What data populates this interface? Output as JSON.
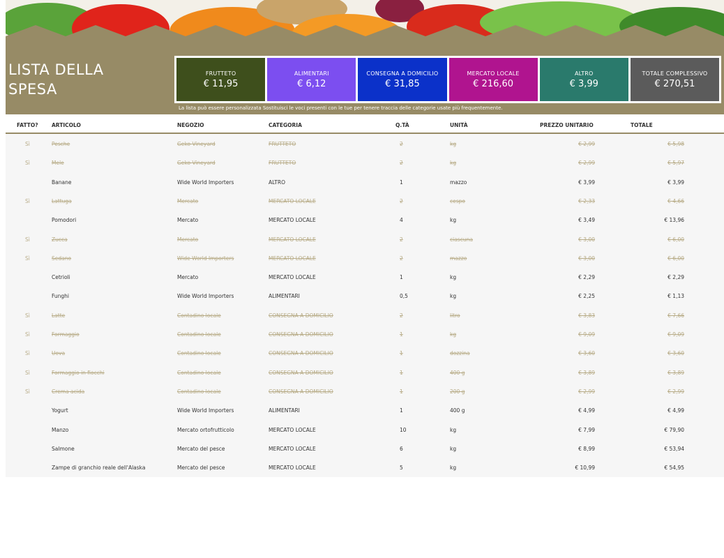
{
  "header": {
    "title_line1": "LISTA DELLA",
    "title_line2": "SPESA",
    "note": "La lista può essere personalizzata Sostituisci le voci presenti con le tue per tenere traccia delle categorie usate più frequentemente."
  },
  "summary": [
    {
      "label": "FRUTTETO",
      "value": "€ 11,95",
      "color": "#3e4f1c"
    },
    {
      "label": "ALIMENTARI",
      "value": "€ 6,12",
      "color": "#7c4ef0"
    },
    {
      "label": "CONSEGNA A DOMICILIO",
      "value": "€ 31,85",
      "color": "#0b31c9"
    },
    {
      "label": "MERCATO LOCALE",
      "value": "€ 216,60",
      "color": "#b0148f"
    },
    {
      "label": "ALTRO",
      "value": "€ 3,99",
      "color": "#2a7a6c"
    },
    {
      "label": "TOTALE COMPLESSIVO",
      "value": "€ 270,51",
      "color": "#5b5b5b"
    }
  ],
  "columns": {
    "fatto": "FATTO?",
    "articolo": "ARTICOLO",
    "negozio": "NEGOZIO",
    "categoria": "CATEGORIA",
    "qta": "Q.TÀ",
    "unita": "UNITÀ",
    "prezzo": "PREZZO UNITARIO",
    "totale": "TOTALE"
  },
  "rows": [
    {
      "done": true,
      "fatto": "Sì",
      "articolo": "Pesche",
      "negozio": "Geko Vineyard",
      "categoria": "FRUTTETO",
      "qta": "2",
      "unita": "kg",
      "prezzo": "€ 2,99",
      "totale": "€ 5,98"
    },
    {
      "done": true,
      "fatto": "Sì",
      "articolo": "Mele",
      "negozio": "Geko Vineyard",
      "categoria": "FRUTTETO",
      "qta": "2",
      "unita": "kg",
      "prezzo": "€ 2,99",
      "totale": "€ 5,97"
    },
    {
      "done": false,
      "fatto": "",
      "articolo": "Banane",
      "negozio": "Wide World Importers",
      "categoria": "ALTRO",
      "qta": "1",
      "unita": "mazzo",
      "prezzo": "€ 3,99",
      "totale": "€ 3,99"
    },
    {
      "done": true,
      "fatto": "Sì",
      "articolo": "Lattuga",
      "negozio": "Mercato",
      "categoria": "MERCATO LOCALE",
      "qta": "2",
      "unita": "cespo",
      "prezzo": "€ 2,33",
      "totale": "€ 4,66"
    },
    {
      "done": false,
      "fatto": "",
      "articolo": "Pomodori",
      "negozio": "Mercato",
      "categoria": "MERCATO LOCALE",
      "qta": "4",
      "unita": "kg",
      "prezzo": "€ 3,49",
      "totale": "€ 13,96"
    },
    {
      "done": true,
      "fatto": "Sì",
      "articolo": "Zucca",
      "negozio": "Mercato",
      "categoria": "MERCATO LOCALE",
      "qta": "2",
      "unita": "ciascuna",
      "prezzo": "€ 3,00",
      "totale": "€ 6,00"
    },
    {
      "done": true,
      "fatto": "Sì",
      "articolo": "Sedano",
      "negozio": "Wide World Importers",
      "categoria": "MERCATO LOCALE",
      "qta": "2",
      "unita": "mazzo",
      "prezzo": "€ 3,00",
      "totale": "€ 6,00"
    },
    {
      "done": false,
      "fatto": "",
      "articolo": "Cetrioli",
      "negozio": "Mercato",
      "categoria": "MERCATO LOCALE",
      "qta": "1",
      "unita": "kg",
      "prezzo": "€ 2,29",
      "totale": "€ 2,29"
    },
    {
      "done": false,
      "fatto": "",
      "articolo": "Funghi",
      "negozio": "Wide World Importers",
      "categoria": "ALIMENTARI",
      "qta": "0,5",
      "unita": "kg",
      "prezzo": "€ 2,25",
      "totale": "€ 1,13"
    },
    {
      "done": true,
      "fatto": "Sì",
      "articolo": "Latte",
      "negozio": "Contadino locale",
      "categoria": "CONSEGNA A DOMICILIO",
      "qta": "2",
      "unita": "litro",
      "prezzo": "€ 3,83",
      "totale": "€ 7,66"
    },
    {
      "done": true,
      "fatto": "Sì",
      "articolo": "Formaggio",
      "negozio": "Contadino locale",
      "categoria": "CONSEGNA A DOMICILIO",
      "qta": "1",
      "unita": "kg",
      "prezzo": "€ 9,09",
      "totale": "€ 9,09"
    },
    {
      "done": true,
      "fatto": "Sì",
      "articolo": "Uova",
      "negozio": "Contadino locale",
      "categoria": "CONSEGNA A DOMICILIO",
      "qta": "1",
      "unita": "dozzina",
      "prezzo": "€ 3,60",
      "totale": "€ 3,60"
    },
    {
      "done": true,
      "fatto": "Sì",
      "articolo": "Formaggio in fiocchi",
      "negozio": "Contadino locale",
      "categoria": "CONSEGNA A DOMICILIO",
      "qta": "1",
      "unita": "400 g",
      "prezzo": "€ 3,89",
      "totale": "€ 3,89"
    },
    {
      "done": true,
      "fatto": "Sì",
      "articolo": "Crema acida",
      "negozio": "Contadino locale",
      "categoria": "CONSEGNA A DOMICILIO",
      "qta": "1",
      "unita": "200 g",
      "prezzo": "€ 2,99",
      "totale": "€ 2,99"
    },
    {
      "done": false,
      "fatto": "",
      "articolo": "Yogurt",
      "negozio": "Wide World Importers",
      "categoria": "ALIMENTARI",
      "qta": "1",
      "unita": "400 g",
      "prezzo": "€ 4,99",
      "totale": "€ 4,99"
    },
    {
      "done": false,
      "fatto": "",
      "articolo": "Manzo",
      "negozio": "Mercato ortofrutticolo",
      "categoria": "MERCATO LOCALE",
      "qta": "10",
      "unita": "kg",
      "prezzo": "€ 7,99",
      "totale": "€ 79,90"
    },
    {
      "done": false,
      "fatto": "",
      "articolo": "Salmone",
      "negozio": "Mercato del pesce",
      "categoria": "MERCATO LOCALE",
      "qta": "6",
      "unita": "kg",
      "prezzo": "€ 8,99",
      "totale": "€ 53,94"
    },
    {
      "done": false,
      "fatto": "",
      "articolo": "Zampe di granchio reale dell'Alaska",
      "negozio": "Mercato del pesce",
      "categoria": "MERCATO LOCALE",
      "qta": "5",
      "unita": "kg",
      "prezzo": "€ 10,99",
      "totale": "€ 54,95"
    }
  ]
}
